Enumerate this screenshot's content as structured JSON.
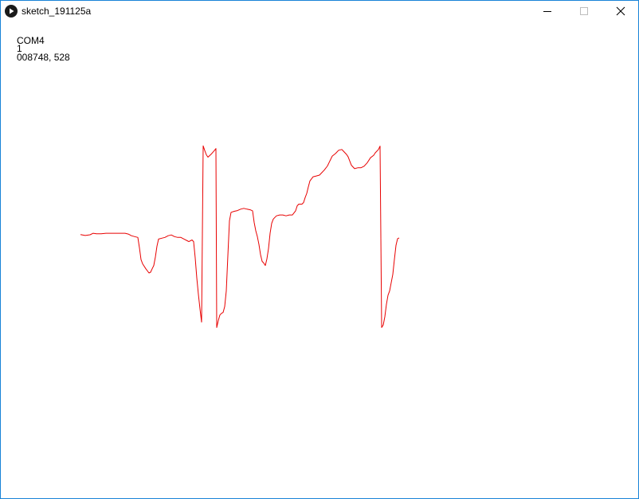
{
  "window": {
    "title": "sketch_191125a",
    "border_color": "#1883d7",
    "app_icon": "play-icon",
    "controls": {
      "minimize_icon": "minimize-icon",
      "maximize_icon": "maximize-icon",
      "close_icon": "close-icon"
    }
  },
  "sketch": {
    "port": "COM4",
    "count": "1",
    "reading": "008748, 528",
    "trace_color": "#e80000",
    "background": "#ffffff"
  },
  "chart_data": {
    "type": "line",
    "title": "",
    "xlabel": "",
    "ylabel": "",
    "grid": false,
    "legend": false,
    "series": [
      {
        "color": "#e80000",
        "values": [
          [
            100,
            293.8
          ],
          [
            106,
            294.9
          ],
          [
            112,
            294.0
          ],
          [
            116,
            292.1
          ],
          [
            120,
            292.8
          ],
          [
            126,
            292.8
          ],
          [
            132,
            292.1
          ],
          [
            140,
            292.1
          ],
          [
            150,
            292.1
          ],
          [
            156,
            292.1
          ],
          [
            160,
            293.1
          ],
          [
            164,
            295.2
          ],
          [
            168,
            296.3
          ],
          [
            172,
            297.3
          ],
          [
            174,
            310.3
          ],
          [
            176,
            325.2
          ],
          [
            178,
            330.5
          ],
          [
            182,
            336.7
          ],
          [
            186,
            342.0
          ],
          [
            188,
            341.0
          ],
          [
            190,
            336.7
          ],
          [
            192,
            332.6
          ],
          [
            194,
            322.0
          ],
          [
            196,
            308.3
          ],
          [
            198,
            299.4
          ],
          [
            202,
            298.3
          ],
          [
            206,
            297.3
          ],
          [
            210,
            295.2
          ],
          [
            214,
            294.2
          ],
          [
            218,
            296.3
          ],
          [
            222,
            297.3
          ],
          [
            226,
            297.3
          ],
          [
            230,
            299.4
          ],
          [
            234,
            301.5
          ],
          [
            236,
            302.6
          ],
          [
            240,
            300.5
          ],
          [
            242,
            302.6
          ],
          [
            244,
            323.1
          ],
          [
            246,
            348.3
          ],
          [
            248,
            368.8
          ],
          [
            250,
            387.2
          ],
          [
            252,
            403.8
          ],
          [
            254,
            182.3
          ],
          [
            256,
            188.2
          ],
          [
            258,
            193.5
          ],
          [
            260,
            196.5
          ],
          [
            264,
            192.8
          ],
          [
            268,
            188.2
          ],
          [
            270,
            185.7
          ],
          [
            271,
            410.5
          ],
          [
            273,
            401.8
          ],
          [
            275,
            394.8
          ],
          [
            277,
            392.7
          ],
          [
            279,
            391.6
          ],
          [
            281,
            384.3
          ],
          [
            283,
            364.6
          ],
          [
            285,
            319.9
          ],
          [
            287,
            276.4
          ],
          [
            289,
            265.8
          ],
          [
            293,
            264.5
          ],
          [
            297,
            263.6
          ],
          [
            301,
            261.8
          ],
          [
            305,
            260.8
          ],
          [
            309,
            261.8
          ],
          [
            313,
            262.6
          ],
          [
            316,
            263.9
          ],
          [
            318,
            278.5
          ],
          [
            320,
            288.9
          ],
          [
            322,
            296.3
          ],
          [
            324,
            306.2
          ],
          [
            326,
            319.0
          ],
          [
            328,
            327.4
          ],
          [
            330,
            329.5
          ],
          [
            332,
            332.6
          ],
          [
            334,
            324.2
          ],
          [
            336,
            311.3
          ],
          [
            338,
            292.1
          ],
          [
            340,
            279.6
          ],
          [
            342,
            274.3
          ],
          [
            344,
            272.2
          ],
          [
            346,
            270.2
          ],
          [
            350,
            269.1
          ],
          [
            354,
            269.1
          ],
          [
            358,
            270.2
          ],
          [
            362,
            269.1
          ],
          [
            366,
            269.1
          ],
          [
            370,
            263.9
          ],
          [
            372,
            257.6
          ],
          [
            374,
            255.5
          ],
          [
            378,
            255.5
          ],
          [
            380,
            253.5
          ],
          [
            382,
            247.2
          ],
          [
            384,
            242.0
          ],
          [
            386,
            233.7
          ],
          [
            388,
            226.3
          ],
          [
            392,
            221.1
          ],
          [
            396,
            220.1
          ],
          [
            400,
            219.0
          ],
          [
            402,
            216.9
          ],
          [
            406,
            212.7
          ],
          [
            410,
            207.5
          ],
          [
            412,
            203.3
          ],
          [
            416,
            195.1
          ],
          [
            420,
            192.0
          ],
          [
            424,
            187.8
          ],
          [
            428,
            186.8
          ],
          [
            430,
            188.9
          ],
          [
            434,
            193.1
          ],
          [
            436,
            196.2
          ],
          [
            438,
            201.4
          ],
          [
            440,
            206.6
          ],
          [
            444,
            210.9
          ],
          [
            448,
            209.8
          ],
          [
            452,
            209.8
          ],
          [
            456,
            207.8
          ],
          [
            460,
            203.4
          ],
          [
            464,
            197.2
          ],
          [
            468,
            194.1
          ],
          [
            470,
            191.0
          ],
          [
            474,
            186.8
          ],
          [
            476,
            182.6
          ],
          [
            478,
            410.5
          ],
          [
            480,
            407.4
          ],
          [
            482,
            397.0
          ],
          [
            484,
            381.3
          ],
          [
            486,
            369.9
          ],
          [
            488,
            364.6
          ],
          [
            490,
            354.2
          ],
          [
            492,
            343.8
          ],
          [
            494,
            324.9
          ],
          [
            496,
            307.3
          ],
          [
            498,
            298.9
          ],
          [
            500,
            297.9
          ]
        ]
      }
    ]
  }
}
